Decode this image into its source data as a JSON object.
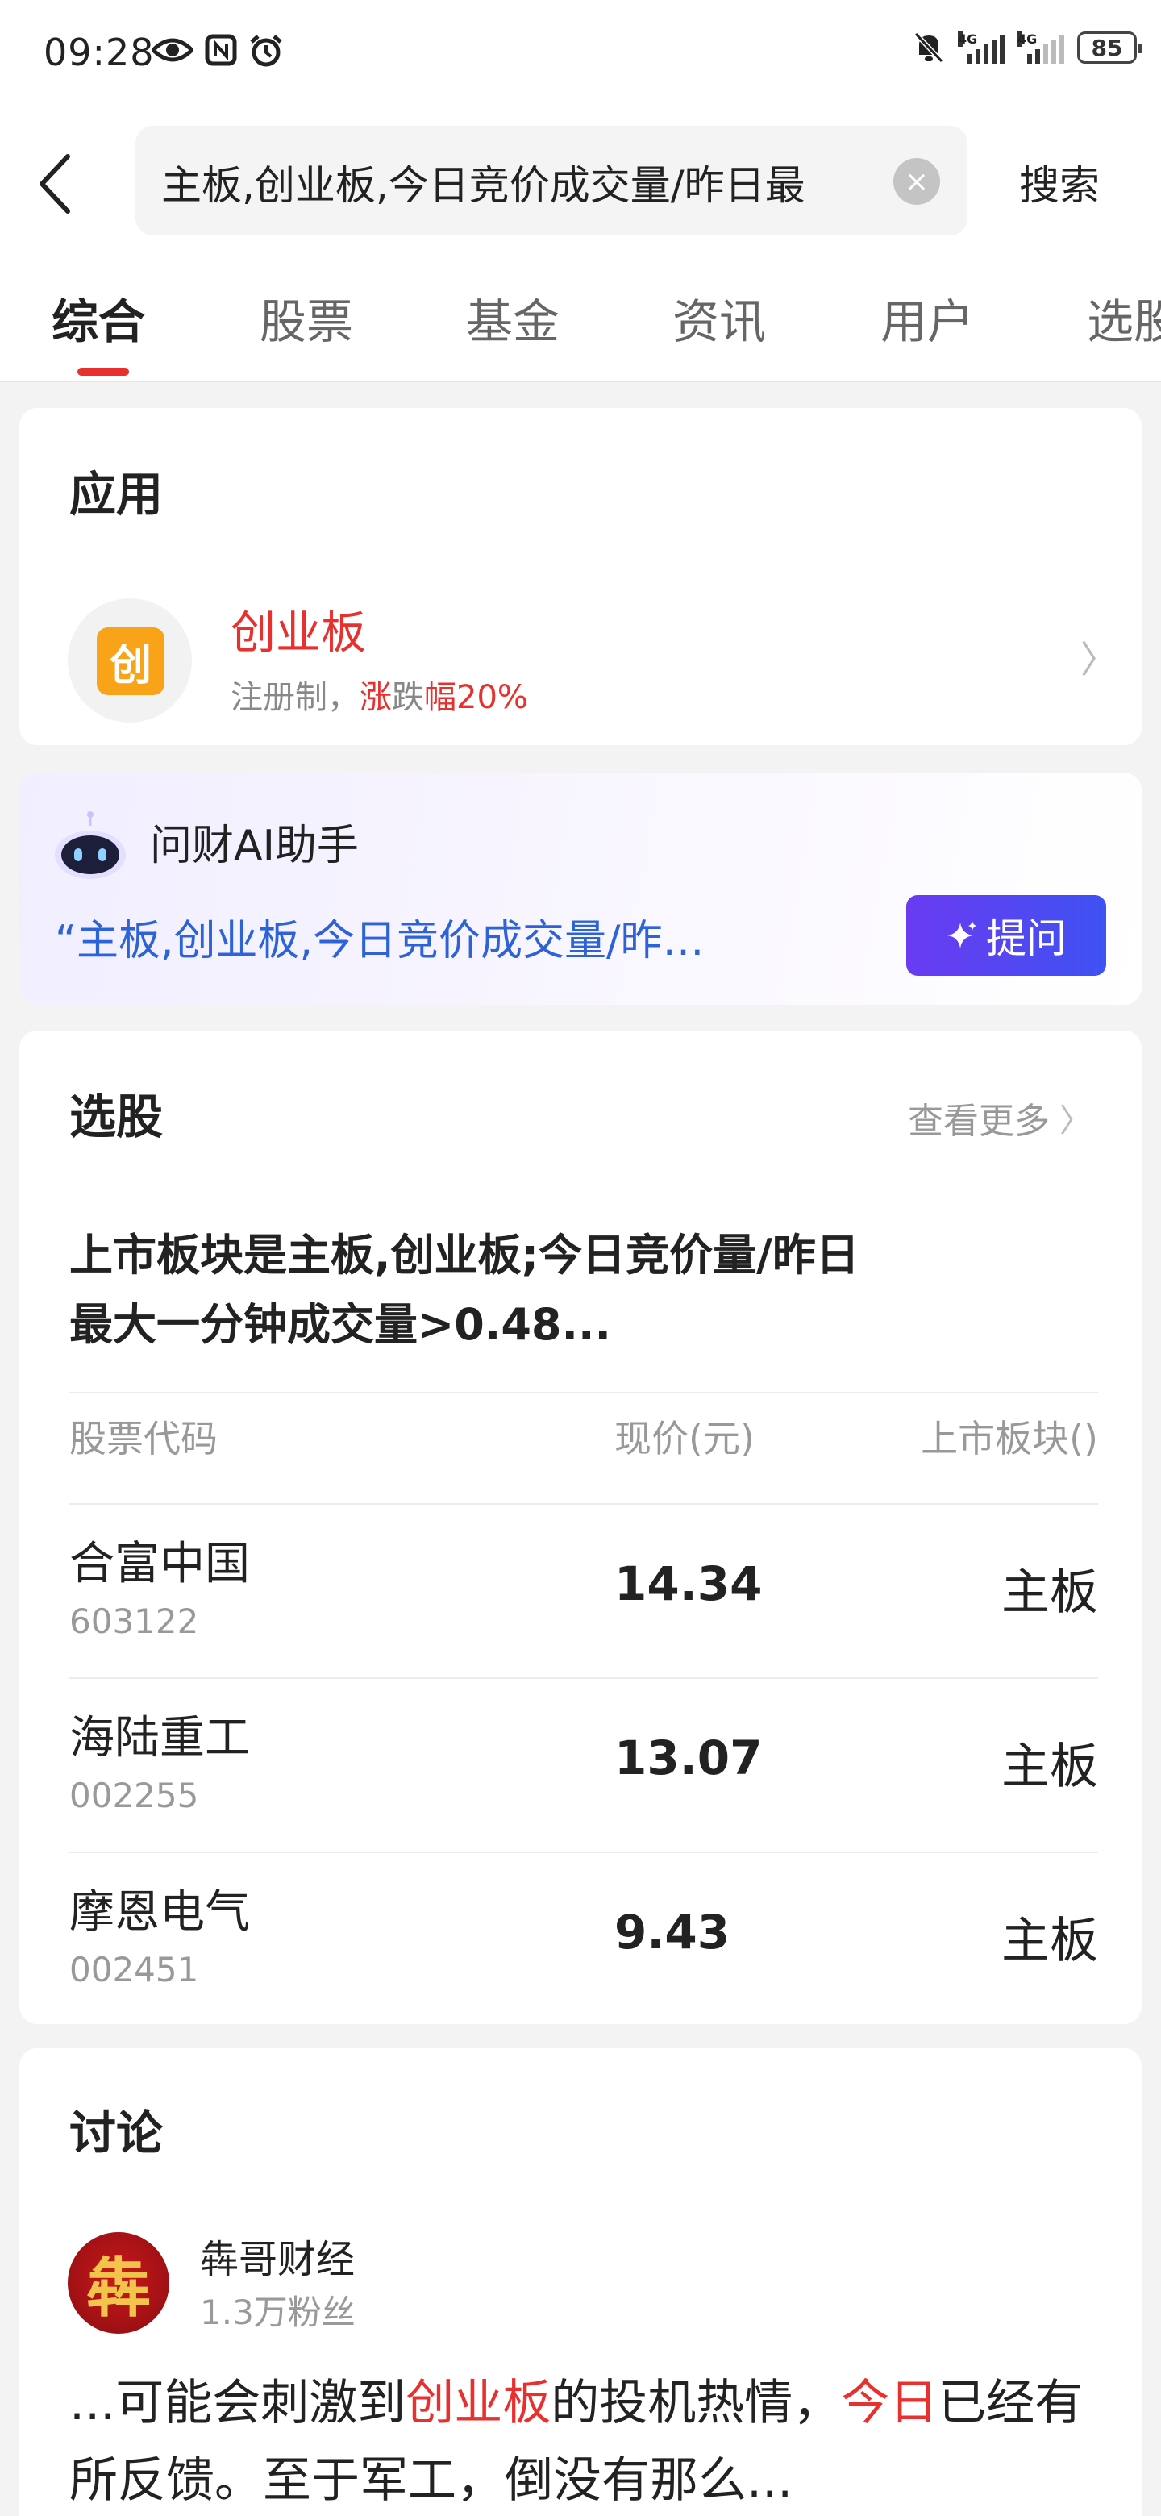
{
  "status_bar": {
    "time": "09:28",
    "network_1": "4G",
    "network_2": "4G",
    "battery": "85"
  },
  "header": {
    "search_value": "主板,创业板,今日竞价成交量/昨日最",
    "search_button": "搜索"
  },
  "tabs": [
    {
      "label": "综合",
      "active": true
    },
    {
      "label": "股票",
      "active": false
    },
    {
      "label": "基金",
      "active": false
    },
    {
      "label": "资讯",
      "active": false
    },
    {
      "label": "用户",
      "active": false
    },
    {
      "label": "选股",
      "active": false
    }
  ],
  "apps_section": {
    "title": "应用",
    "app": {
      "icon_char": "创",
      "name": "创业板",
      "desc_prefix": "注册制，",
      "desc_highlight_1": "涨",
      "desc_mid": "跌",
      "desc_highlight_2": "幅20%"
    }
  },
  "ai_assistant": {
    "title": "问财AI助手",
    "quote": "“主板,创业板,今日竞价成交量/昨…",
    "ask_button": "提问"
  },
  "stock_picker": {
    "title": "选股",
    "more_link": "查看更多",
    "query": "上市板块是主板,创业板;今日竞价量/昨日最大一分钟成交量>0.48...",
    "columns": [
      "股票代码",
      "现价(元)",
      "上市板块()"
    ],
    "rows": [
      {
        "name": "合富中国",
        "code": "603122",
        "price": "14.34",
        "board": "主板"
      },
      {
        "name": "海陆重工",
        "code": "002255",
        "price": "13.07",
        "board": "主板"
      },
      {
        "name": "摩恩电气",
        "code": "002451",
        "price": "9.43",
        "board": "主板"
      }
    ]
  },
  "discussion": {
    "title": "讨论",
    "avatar_char": "犇",
    "author": "犇哥财经",
    "fans": "1.3万粉丝",
    "post_part_1": "...可能会刺激到",
    "post_highlight_1": "创业板",
    "post_part_2": "的投机热情，",
    "post_highlight_2": "今日",
    "post_part_3": "已经有所反馈。至于军工，倒没有那么..."
  },
  "colors": {
    "accent_red": "#e8312f",
    "link_blue": "#2d63d6",
    "ask_button_start": "#6a3bf2",
    "ask_button_end": "#3f52f3",
    "app_icon_orange": "#f8a318"
  }
}
